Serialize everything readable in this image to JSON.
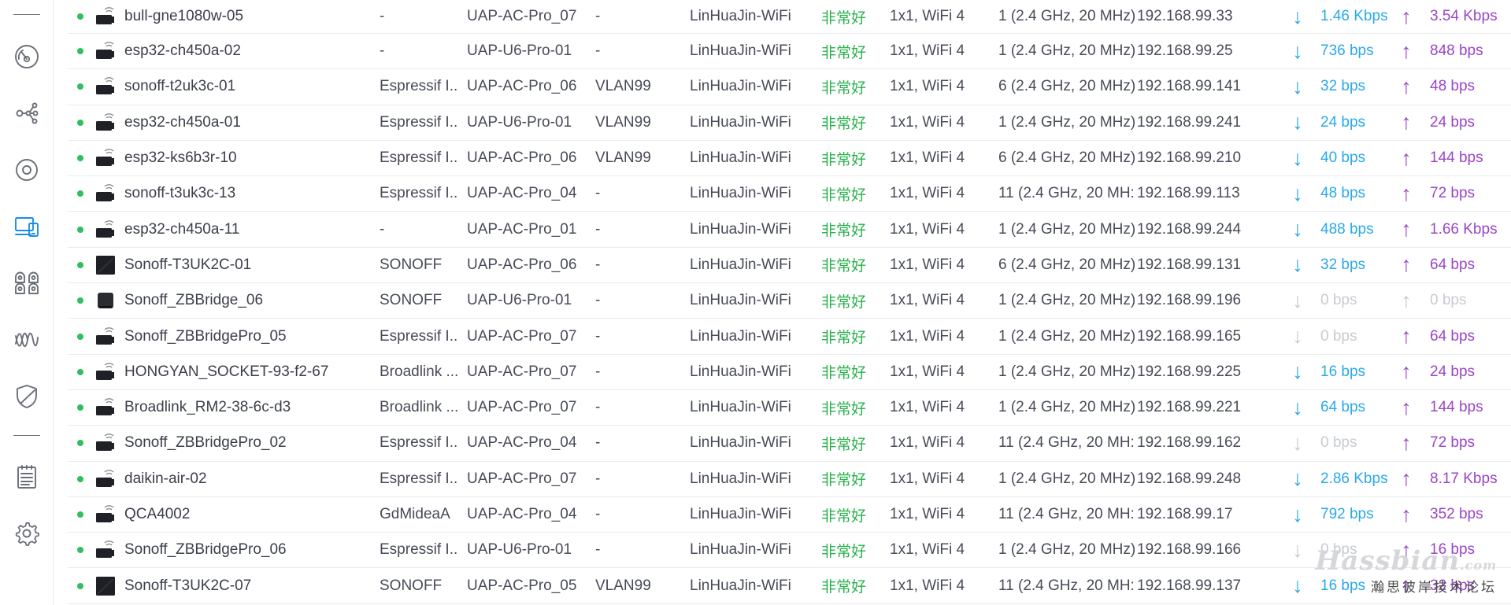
{
  "sidebar": {
    "items": [
      {
        "icon": "dashboard-icon",
        "active": false
      },
      {
        "icon": "topology-icon",
        "active": false
      },
      {
        "icon": "devices-icon",
        "active": false
      },
      {
        "icon": "clients-icon",
        "active": true
      },
      {
        "icon": "statistics-icon",
        "active": false
      },
      {
        "icon": "insights-icon",
        "active": false
      },
      {
        "icon": "security-icon",
        "active": false
      },
      {
        "icon": "logs-icon",
        "active": false
      },
      {
        "icon": "settings-icon",
        "active": false
      }
    ]
  },
  "colors": {
    "online": "#2fbf5b",
    "experience": "#28b24b",
    "rx": "#29a9ea",
    "tx": "#9b45c8",
    "inactive": "#c7cbd1",
    "active_nav": "#1a8ee6"
  },
  "arrows": {
    "down": "↓",
    "up": "↑"
  },
  "clients": [
    {
      "name": "bull-gne1080w-05",
      "icon": "wifi-device-icon",
      "vendor": "-",
      "ap": "UAP-AC-Pro_07",
      "vlan": "-",
      "ssid": "LinHuaJin-WiFi",
      "experience": "非常好",
      "tech": "1x1, WiFi 4",
      "channel": "1 (2.4 GHz, 20 MHz)",
      "ip": "192.168.99.33",
      "rx": "1.46 Kbps",
      "tx": "3.54 Kbps"
    },
    {
      "name": "esp32-ch450a-02",
      "icon": "wifi-device-icon",
      "vendor": "-",
      "ap": "UAP-U6-Pro-01",
      "vlan": "-",
      "ssid": "LinHuaJin-WiFi",
      "experience": "非常好",
      "tech": "1x1, WiFi 4",
      "channel": "1 (2.4 GHz, 20 MHz)",
      "ip": "192.168.99.25",
      "rx": "736 bps",
      "tx": "848 bps"
    },
    {
      "name": "sonoff-t2uk3c-01",
      "icon": "wifi-device-icon",
      "vendor": "Espressif I...",
      "ap": "UAP-AC-Pro_06",
      "vlan": "VLAN99",
      "ssid": "LinHuaJin-WiFi",
      "experience": "非常好",
      "tech": "1x1, WiFi 4",
      "channel": "6 (2.4 GHz, 20 MHz)",
      "ip": "192.168.99.141",
      "rx": "32 bps",
      "tx": "48 bps"
    },
    {
      "name": "esp32-ch450a-01",
      "icon": "wifi-device-icon",
      "vendor": "Espressif I...",
      "ap": "UAP-U6-Pro-01",
      "vlan": "VLAN99",
      "ssid": "LinHuaJin-WiFi",
      "experience": "非常好",
      "tech": "1x1, WiFi 4",
      "channel": "1 (2.4 GHz, 20 MHz)",
      "ip": "192.168.99.241",
      "rx": "24 bps",
      "tx": "24 bps"
    },
    {
      "name": "esp32-ks6b3r-10",
      "icon": "wifi-device-icon",
      "vendor": "Espressif I...",
      "ap": "UAP-AC-Pro_06",
      "vlan": "VLAN99",
      "ssid": "LinHuaJin-WiFi",
      "experience": "非常好",
      "tech": "1x1, WiFi 4",
      "channel": "6 (2.4 GHz, 20 MHz)",
      "ip": "192.168.99.210",
      "rx": "40 bps",
      "tx": "144 bps"
    },
    {
      "name": "sonoff-t3uk3c-13",
      "icon": "wifi-device-icon",
      "vendor": "Espressif I...",
      "ap": "UAP-AC-Pro_04",
      "vlan": "-",
      "ssid": "LinHuaJin-WiFi",
      "experience": "非常好",
      "tech": "1x1, WiFi 4",
      "channel": "11 (2.4 GHz, 20 MH:",
      "ip": "192.168.99.113",
      "rx": "48 bps",
      "tx": "72 bps"
    },
    {
      "name": "esp32-ch450a-11",
      "icon": "wifi-device-icon",
      "vendor": "-",
      "ap": "UAP-AC-Pro_01",
      "vlan": "-",
      "ssid": "LinHuaJin-WiFi",
      "experience": "非常好",
      "tech": "1x1, WiFi 4",
      "channel": "1 (2.4 GHz, 20 MHz)",
      "ip": "192.168.99.244",
      "rx": "488 bps",
      "tx": "1.66 Kbps"
    },
    {
      "name": "Sonoff-T3UK2C-01",
      "icon": "switch-panel-icon",
      "vendor": "SONOFF",
      "ap": "UAP-AC-Pro_06",
      "vlan": "-",
      "ssid": "LinHuaJin-WiFi",
      "experience": "非常好",
      "tech": "1x1, WiFi 4",
      "channel": "6 (2.4 GHz, 20 MHz)",
      "ip": "192.168.99.131",
      "rx": "32 bps",
      "tx": "64 bps"
    },
    {
      "name": "Sonoff_ZBBridge_06",
      "icon": "bridge-box-icon",
      "vendor": "SONOFF",
      "ap": "UAP-U6-Pro-01",
      "vlan": "-",
      "ssid": "LinHuaJin-WiFi",
      "experience": "非常好",
      "tech": "1x1, WiFi 4",
      "channel": "1 (2.4 GHz, 20 MHz)",
      "ip": "192.168.99.196",
      "rx": "0 bps",
      "tx": "0 bps"
    },
    {
      "name": "Sonoff_ZBBridgePro_05",
      "icon": "wifi-device-icon",
      "vendor": "Espressif I...",
      "ap": "UAP-AC-Pro_07",
      "vlan": "-",
      "ssid": "LinHuaJin-WiFi",
      "experience": "非常好",
      "tech": "1x1, WiFi 4",
      "channel": "1 (2.4 GHz, 20 MHz)",
      "ip": "192.168.99.165",
      "rx": "0 bps",
      "tx": "64 bps"
    },
    {
      "name": "HONGYAN_SOCKET-93-f2-67",
      "icon": "wifi-device-icon",
      "vendor": "Broadlink ...",
      "ap": "UAP-AC-Pro_07",
      "vlan": "-",
      "ssid": "LinHuaJin-WiFi",
      "experience": "非常好",
      "tech": "1x1, WiFi 4",
      "channel": "1 (2.4 GHz, 20 MHz)",
      "ip": "192.168.99.225",
      "rx": "16 bps",
      "tx": "24 bps"
    },
    {
      "name": "Broadlink_RM2-38-6c-d3",
      "icon": "wifi-device-icon",
      "vendor": "Broadlink ...",
      "ap": "UAP-AC-Pro_07",
      "vlan": "-",
      "ssid": "LinHuaJin-WiFi",
      "experience": "非常好",
      "tech": "1x1, WiFi 4",
      "channel": "1 (2.4 GHz, 20 MHz)",
      "ip": "192.168.99.221",
      "rx": "64 bps",
      "tx": "144 bps"
    },
    {
      "name": "Sonoff_ZBBridgePro_02",
      "icon": "wifi-device-icon",
      "vendor": "Espressif I...",
      "ap": "UAP-AC-Pro_04",
      "vlan": "-",
      "ssid": "LinHuaJin-WiFi",
      "experience": "非常好",
      "tech": "1x1, WiFi 4",
      "channel": "11 (2.4 GHz, 20 MH:",
      "ip": "192.168.99.162",
      "rx": "0 bps",
      "tx": "72 bps"
    },
    {
      "name": "daikin-air-02",
      "icon": "wifi-device-icon",
      "vendor": "Espressif I...",
      "ap": "UAP-AC-Pro_07",
      "vlan": "-",
      "ssid": "LinHuaJin-WiFi",
      "experience": "非常好",
      "tech": "1x1, WiFi 4",
      "channel": "1 (2.4 GHz, 20 MHz)",
      "ip": "192.168.99.248",
      "rx": "2.86 Kbps",
      "tx": "8.17 Kbps"
    },
    {
      "name": "QCA4002",
      "icon": "wifi-device-icon",
      "vendor": "GdMideaA",
      "ap": "UAP-AC-Pro_04",
      "vlan": "-",
      "ssid": "LinHuaJin-WiFi",
      "experience": "非常好",
      "tech": "1x1, WiFi 4",
      "channel": "11 (2.4 GHz, 20 MH:",
      "ip": "192.168.99.17",
      "rx": "792 bps",
      "tx": "352 bps"
    },
    {
      "name": "Sonoff_ZBBridgePro_06",
      "icon": "wifi-device-icon",
      "vendor": "Espressif I...",
      "ap": "UAP-U6-Pro-01",
      "vlan": "-",
      "ssid": "LinHuaJin-WiFi",
      "experience": "非常好",
      "tech": "1x1, WiFi 4",
      "channel": "1 (2.4 GHz, 20 MHz)",
      "ip": "192.168.99.166",
      "rx": "0 bps",
      "tx": "16 bps"
    },
    {
      "name": "Sonoff-T3UK2C-07",
      "icon": "switch-panel-icon",
      "vendor": "SONOFF",
      "ap": "UAP-AC-Pro_05",
      "vlan": "VLAN99",
      "ssid": "LinHuaJin-WiFi",
      "experience": "非常好",
      "tech": "1x1, WiFi 4",
      "channel": "11 (2.4 GHz, 20 MH:",
      "ip": "192.168.99.137",
      "rx": "16 bps",
      "tx": "32 bps"
    }
  ],
  "watermark": {
    "logo": "Hassbian",
    "suffix": ".com",
    "subtitle": "瀚思彼岸技术论坛"
  }
}
